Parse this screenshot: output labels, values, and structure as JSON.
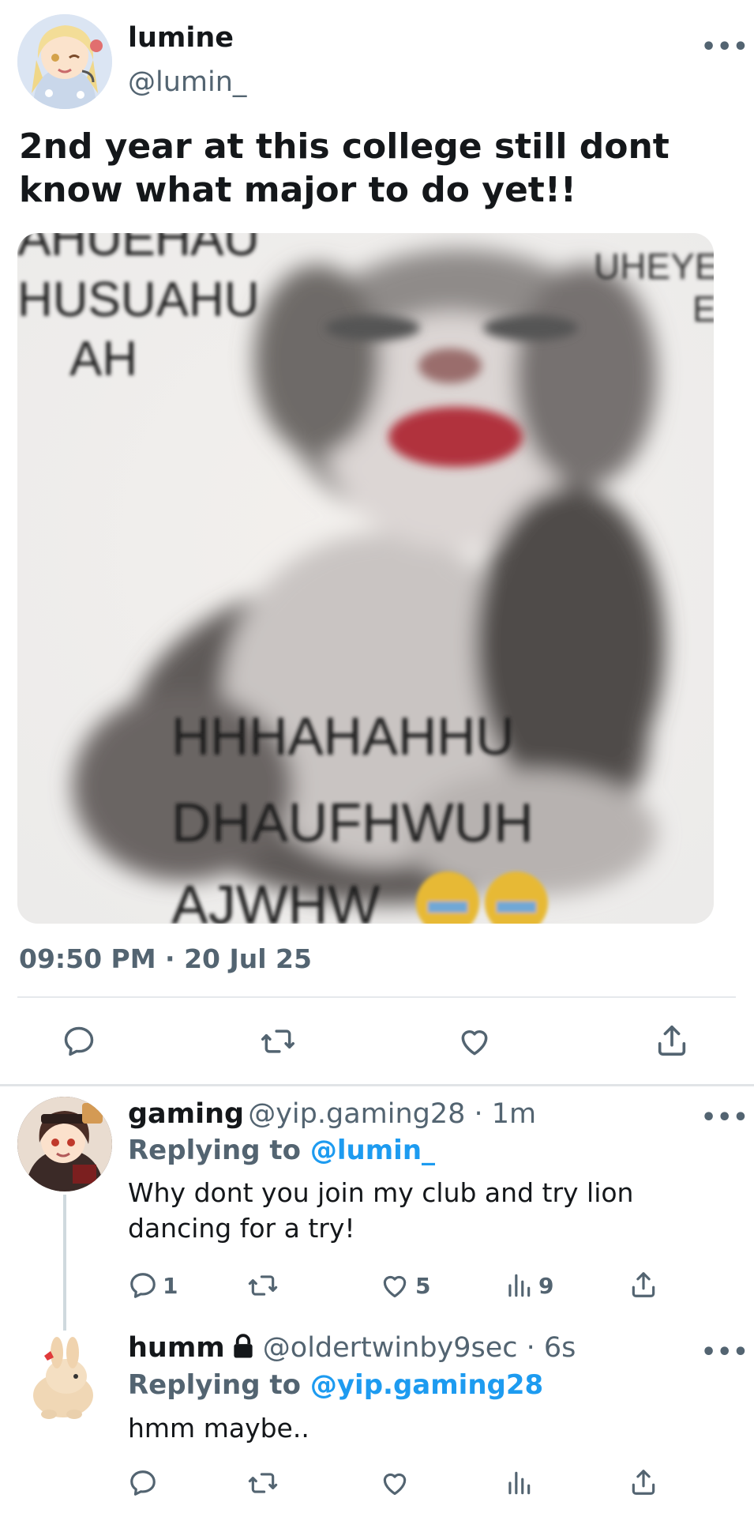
{
  "main_tweet": {
    "display_name": "lumine",
    "handle": "@lumin_",
    "more_label": "•••",
    "text": "2nd year at this college still dont know what major to do yet!!",
    "media": {
      "top_left_text_1": "AHUEHAU",
      "top_left_text_2": "HUSUAHU",
      "top_left_text_3": "AH",
      "top_right_text_1": "UHEYE",
      "top_right_text_2": "E",
      "bottom_text_1": "HHHAHAHHU",
      "bottom_text_2": "DHAUFHWUH",
      "bottom_text_3": "AJWHW"
    },
    "timestamp": "09:50 PM · 20 Jul 25",
    "actions": [
      "reply-icon",
      "retweet-icon",
      "like-icon",
      "share-icon"
    ]
  },
  "replies": [
    {
      "display_name": "gaming",
      "handle_time": "@yip.gaming28 · 1m",
      "replying_prefix": "Replying to ",
      "replying_mention": "@lumin_",
      "text_line_1": "Why dont you join my club and try lion",
      "text_line_2": "dancing for a try!",
      "reply_count": "1",
      "like_count": "5",
      "views_count": "9",
      "more_label": "•••"
    },
    {
      "display_name": "humm",
      "handle_time": "@oldertwinby9sec · 6s",
      "replying_prefix": "Replying to ",
      "replying_mention": "@yip.gaming28",
      "text": "hmm maybe..",
      "more_label": "•••",
      "locked_icon": "lock-icon"
    }
  ],
  "colors": {
    "accent": "#1d9bf0",
    "secondary_text": "#536471",
    "primary_text": "#14171a",
    "divider": "#e6e9ec"
  }
}
